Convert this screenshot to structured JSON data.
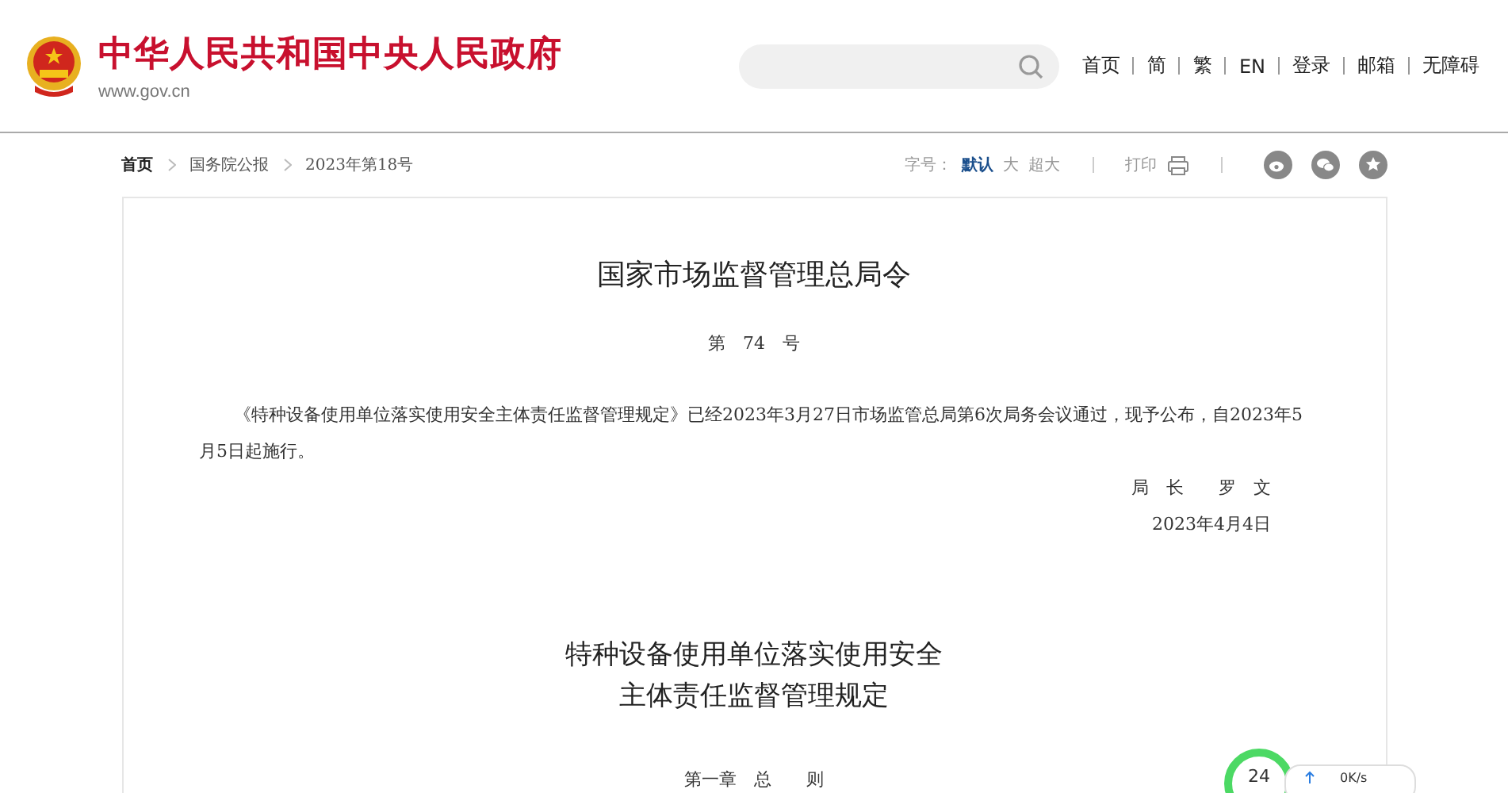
{
  "header": {
    "site_name": "中华人民共和国中央人民政府",
    "url": "www.gov.cn",
    "nav": [
      "首页",
      "简",
      "繁",
      "EN",
      "登录",
      "邮箱",
      "无障碍"
    ]
  },
  "breadcrumb": [
    "首页",
    "国务院公报",
    "2023年第18号"
  ],
  "font_size": {
    "label": "字号：",
    "options": [
      {
        "label": "默认",
        "selected": true
      },
      {
        "label": "大",
        "selected": false
      },
      {
        "label": "超大",
        "selected": false
      }
    ]
  },
  "print": {
    "label": "打印"
  },
  "document": {
    "title": "国家市场监督管理总局令",
    "number": "第　74　号",
    "paragraph": "《特种设备使用单位落实使用安全主体责任监督管理规定》已经2023年3月27日市场监管总局第6次局务会议通过，现予公布，自2023年5月5日起施行。",
    "signer": "局　长　　罗　文",
    "date": "2023年4月4日",
    "rule_title": [
      "特种设备使用单位落实使用安全",
      "主体责任监督管理规定"
    ],
    "chapter": "第一章　总　　则"
  },
  "widget": {
    "count": "24",
    "speed": "0K/s"
  }
}
